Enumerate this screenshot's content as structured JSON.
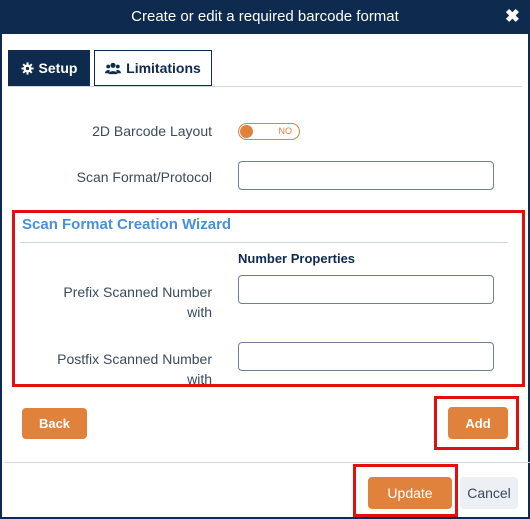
{
  "dialog": {
    "title": "Create or edit a required barcode format",
    "close_glyph": "✖"
  },
  "tabs": [
    {
      "label": "Setup",
      "icon": "gear-icon",
      "active": true
    },
    {
      "label": "Limitations",
      "icon": "users-icon",
      "active": false
    }
  ],
  "form": {
    "layout_label": "2D Barcode Layout",
    "layout_toggle_state": "NO",
    "scan_format_label": "Scan Format/Protocol",
    "scan_format_value": ""
  },
  "wizard": {
    "title": "Scan Format Creation Wizard",
    "section_heading": "Number Properties",
    "prefix_label_line1": "Prefix Scanned Number",
    "prefix_label_line2": "with",
    "prefix_value": "",
    "postfix_label_line1": "Postfix Scanned Number",
    "postfix_label_line2": "with",
    "postfix_value": ""
  },
  "buttons": {
    "back": "Back",
    "add": "Add",
    "update": "Update",
    "cancel": "Cancel"
  },
  "colors": {
    "header": "#0f2a4f",
    "accent": "#e0823c",
    "wizard_title": "#4a90d9",
    "highlight": "#e01010"
  }
}
